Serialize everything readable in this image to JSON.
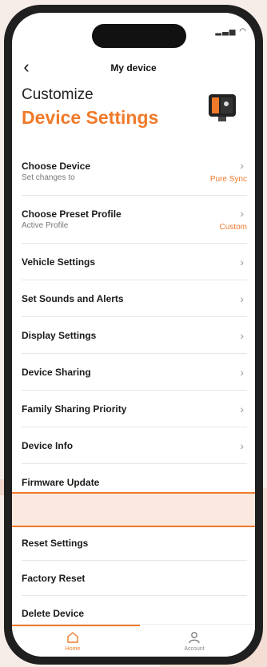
{
  "header": {
    "title": "My device",
    "back_icon": "chevron-left-icon"
  },
  "hero": {
    "line1": "Customize",
    "line2": "Device Settings"
  },
  "colors": {
    "accent": "#f07a2a"
  },
  "settings": [
    {
      "label": "Choose Device",
      "sub": "Set changes to",
      "value": "Pure Sync"
    },
    {
      "label": "Choose Preset Profile",
      "sub": "Active Profile",
      "value": "Custom"
    },
    {
      "label": "Vehicle Settings"
    },
    {
      "label": "Set Sounds and Alerts"
    },
    {
      "label": "Display Settings"
    },
    {
      "label": "Device Sharing"
    },
    {
      "label": "Family Sharing Priority"
    },
    {
      "label": "Device Info"
    },
    {
      "label": "Firmware Update"
    }
  ],
  "actions": [
    {
      "label": "Reset Settings"
    },
    {
      "label": "Factory Reset"
    },
    {
      "label": "Delete Device"
    }
  ],
  "tabbar": {
    "home": "Home",
    "account": "Account"
  }
}
